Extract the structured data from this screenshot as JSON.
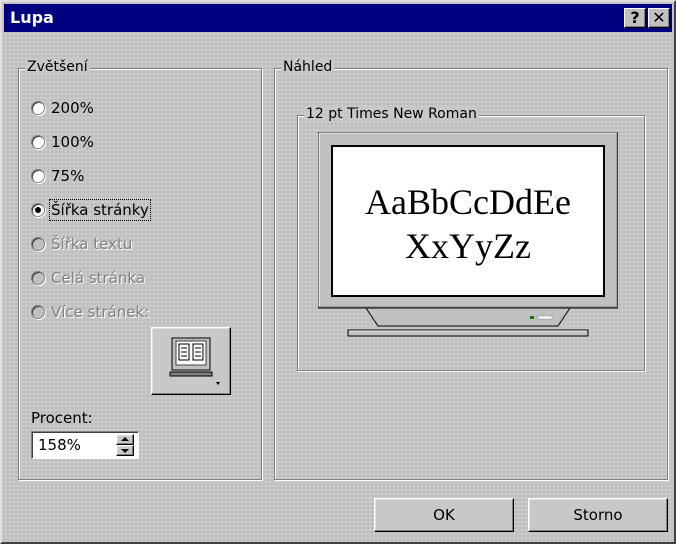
{
  "window": {
    "title": "Lupa",
    "help_btn": "?",
    "close_btn": "✕"
  },
  "zoom_group": {
    "legend": "Zvětšení",
    "options": [
      {
        "label": "200%",
        "checked": false,
        "enabled": true
      },
      {
        "label": "100%",
        "checked": false,
        "enabled": true
      },
      {
        "label": "75%",
        "checked": false,
        "enabled": true
      },
      {
        "label": "Šířka stránky",
        "checked": true,
        "enabled": true
      },
      {
        "label": "Šířka textu",
        "checked": false,
        "enabled": false
      },
      {
        "label": "Celá stránka",
        "checked": false,
        "enabled": false
      },
      {
        "label": "Více stránek:",
        "checked": false,
        "enabled": false
      }
    ],
    "percent_label": "Procent:",
    "percent_value": "158%"
  },
  "preview_group": {
    "legend": "Náhled",
    "font_legend": "12 pt Times New Roman",
    "sample_line1": "AaBbCcDdEe",
    "sample_line2": "XxYyZz"
  },
  "buttons": {
    "ok": "OK",
    "cancel": "Storno"
  }
}
